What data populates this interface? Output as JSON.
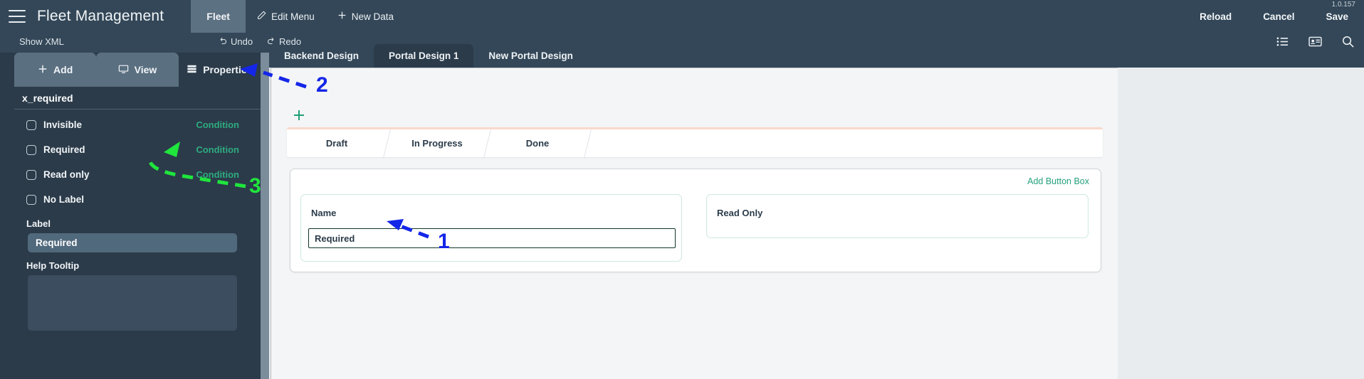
{
  "topnav": {
    "menu_icon": "hamburger-icon",
    "app_title": "Fleet Management",
    "active_tab": "Fleet",
    "edit_menu": "Edit Menu",
    "edit_menu_icon": "pencil-icon",
    "new_data": "New Data",
    "new_data_icon": "plus-icon",
    "reload": "Reload",
    "cancel": "Cancel",
    "save": "Save",
    "version": "1.0.157"
  },
  "subbar": {
    "show_xml": "Show XML",
    "undo": "Undo",
    "undo_icon": "undo-arrow-icon",
    "redo": "Redo",
    "redo_icon": "redo-arrow-icon",
    "icons": [
      "list-icon",
      "card-icon",
      "search-icon"
    ]
  },
  "left_panel": {
    "tabs": [
      {
        "label": "Add",
        "icon": "plus-icon",
        "active": false
      },
      {
        "label": "View",
        "icon": "monitor-icon",
        "active": false
      },
      {
        "label": "Properties",
        "icon": "properties-icon",
        "active": true
      }
    ],
    "field_name": "x_required",
    "checkboxes": [
      {
        "label": "Invisible",
        "checked": false,
        "condition": "Condition"
      },
      {
        "label": "Required",
        "checked": false,
        "condition": "Condition"
      },
      {
        "label": "Read only",
        "checked": false,
        "condition": "Condition"
      },
      {
        "label": "No Label",
        "checked": false,
        "condition": null
      }
    ],
    "label_field": {
      "label": "Label",
      "value": "Required"
    },
    "tooltip_field": {
      "label": "Help Tooltip",
      "value": "",
      "placeholder": ""
    },
    "condition_color": "#2eab7f"
  },
  "main": {
    "design_tabs": [
      {
        "label": "Backend Design",
        "active": false
      },
      {
        "label": "Portal Design 1",
        "active": true
      },
      {
        "label": "New Portal Design",
        "active": false
      }
    ],
    "add_stage_icon": "plus-icon",
    "stages": [
      "Draft",
      "In Progress",
      "Done"
    ],
    "add_button_box": "Add Button Box",
    "fields": [
      {
        "label": "Name",
        "value": "Required",
        "has_input": true
      },
      {
        "label": "Read Only",
        "value": "",
        "has_input": false
      }
    ],
    "accent_color": "#26a17c"
  },
  "annotations": [
    {
      "id": "1",
      "color": "#1426e8",
      "points_to": "name-field-input"
    },
    {
      "id": "2",
      "color": "#1426e8",
      "points_to": "properties-tab"
    },
    {
      "id": "3",
      "color": "#1fe53c",
      "points_to": "required-condition-link"
    }
  ]
}
